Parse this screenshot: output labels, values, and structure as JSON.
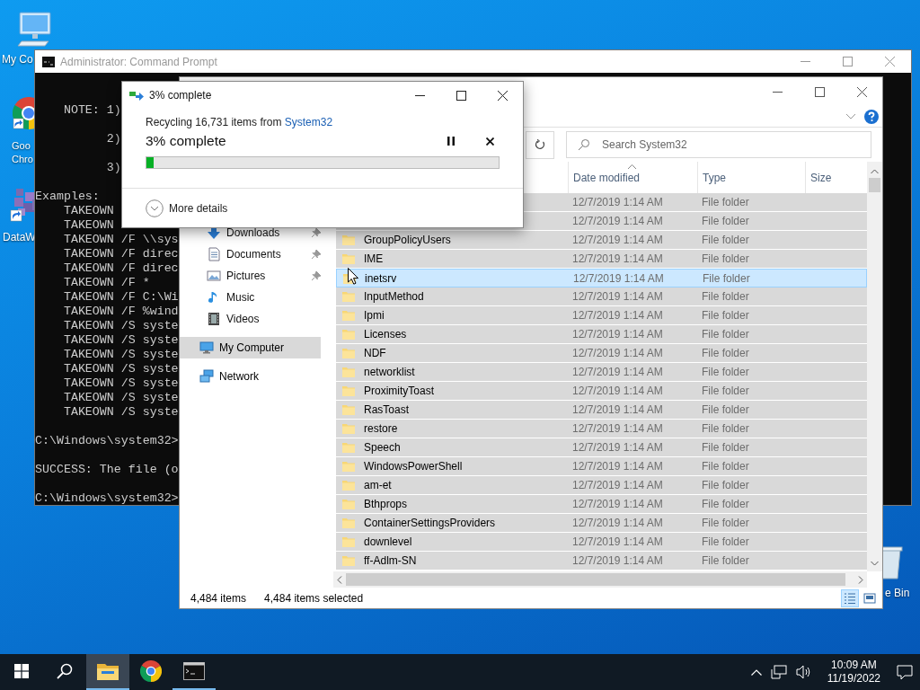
{
  "desktop": {
    "icons": [
      {
        "label": "My Co",
        "kind": "computer",
        "shortcut": false
      },
      {
        "label": "Goo Chro",
        "kind": "chrome",
        "shortcut": true
      },
      {
        "label": "DataW",
        "kind": "app",
        "shortcut": true
      },
      {
        "label": "e Bin",
        "kind": "recycle",
        "shortcut": false
      }
    ]
  },
  "console": {
    "title": "Administrator: Command Prompt",
    "blocks": [
      [
        "    NOTE: 1)"
      ],
      [
        "          2)"
      ],
      [
        "          3)"
      ],
      [
        "Examples:",
        "    TAKEOWN",
        "    TAKEOWN",
        "    TAKEOWN /F \\\\sys",
        "    TAKEOWN /F direc",
        "    TAKEOWN /F direc",
        "    TAKEOWN /F *",
        "    TAKEOWN /F C:\\Wi",
        "    TAKEOWN /F %wind",
        "    TAKEOWN /S syste",
        "    TAKEOWN /S syste",
        "    TAKEOWN /S syste",
        "    TAKEOWN /S syste",
        "    TAKEOWN /S syste",
        "    TAKEOWN /S syste",
        "    TAKEOWN /S syste"
      ],
      [
        "C:\\Windows\\system32>"
      ],
      [
        "SUCCESS: The file (o"
      ],
      [
        "C:\\Windows\\system32>"
      ]
    ]
  },
  "explorer": {
    "search": {
      "placeholder": "Search System32"
    },
    "quick_access": [
      {
        "label": "Downloads",
        "kind": "downloads",
        "pinned": true
      },
      {
        "label": "Documents",
        "kind": "documents",
        "pinned": true
      },
      {
        "label": "Pictures",
        "kind": "pictures",
        "pinned": true
      },
      {
        "label": "Music",
        "kind": "music",
        "pinned": false
      },
      {
        "label": "Videos",
        "kind": "videos",
        "pinned": false
      }
    ],
    "locations": [
      {
        "label": "My Computer",
        "kind": "computer",
        "selected": true
      },
      {
        "label": "Network",
        "kind": "network",
        "selected": false
      }
    ],
    "columns": [
      {
        "label": "Date modified",
        "sorted": true
      },
      {
        "label": "Type",
        "sorted": false
      },
      {
        "label": "Size",
        "sorted": false
      }
    ],
    "rows": [
      {
        "date": "12/7/2019 1:14 AM",
        "type": "File folder",
        "selected": true,
        "hovered": false
      },
      {
        "date": "12/7/2019 1:14 AM",
        "type": "File folder",
        "selected": true,
        "hovered": false
      },
      {
        "name": "GroupPolicyUsers",
        "date": "12/7/2019 1:14 AM",
        "type": "File folder",
        "selected": true,
        "hovered": false
      },
      {
        "name": "IME",
        "date": "12/7/2019 1:14 AM",
        "type": "File folder",
        "selected": true,
        "hovered": false
      },
      {
        "name": "inetsrv",
        "date": "12/7/2019 1:14 AM",
        "type": "File folder",
        "selected": true,
        "hovered": true
      },
      {
        "name": "InputMethod",
        "date": "12/7/2019 1:14 AM",
        "type": "File folder",
        "selected": true,
        "hovered": false
      },
      {
        "name": "Ipmi",
        "date": "12/7/2019 1:14 AM",
        "type": "File folder",
        "selected": true,
        "hovered": false
      },
      {
        "name": "Licenses",
        "date": "12/7/2019 1:14 AM",
        "type": "File folder",
        "selected": true,
        "hovered": false
      },
      {
        "name": "NDF",
        "date": "12/7/2019 1:14 AM",
        "type": "File folder",
        "selected": true,
        "hovered": false
      },
      {
        "name": "networklist",
        "date": "12/7/2019 1:14 AM",
        "type": "File folder",
        "selected": true,
        "hovered": false
      },
      {
        "name": "ProximityToast",
        "date": "12/7/2019 1:14 AM",
        "type": "File folder",
        "selected": true,
        "hovered": false
      },
      {
        "name": "RasToast",
        "date": "12/7/2019 1:14 AM",
        "type": "File folder",
        "selected": true,
        "hovered": false
      },
      {
        "name": "restore",
        "date": "12/7/2019 1:14 AM",
        "type": "File folder",
        "selected": true,
        "hovered": false
      },
      {
        "name": "Speech",
        "date": "12/7/2019 1:14 AM",
        "type": "File folder",
        "selected": true,
        "hovered": false
      },
      {
        "name": "WindowsPowerShell",
        "date": "12/7/2019 1:14 AM",
        "type": "File folder",
        "selected": true,
        "hovered": false
      },
      {
        "name": "am-et",
        "date": "12/7/2019 1:14 AM",
        "type": "File folder",
        "selected": true,
        "hovered": false
      },
      {
        "name": "Bthprops",
        "date": "12/7/2019 1:14 AM",
        "type": "File folder",
        "selected": true,
        "hovered": false
      },
      {
        "name": "ContainerSettingsProviders",
        "date": "12/7/2019 1:14 AM",
        "type": "File folder",
        "selected": true,
        "hovered": false
      },
      {
        "name": "downlevel",
        "date": "12/7/2019 1:14 AM",
        "type": "File folder",
        "selected": true,
        "hovered": false
      },
      {
        "name": "ff-Adlm-SN",
        "date": "12/7/2019 1:14 AM",
        "type": "File folder",
        "selected": true,
        "hovered": false
      }
    ],
    "status": {
      "count": "4,484 items",
      "selection": "4,484 items selected"
    },
    "views": [
      {
        "kind": "details",
        "selected": true
      },
      {
        "kind": "icons",
        "selected": false
      }
    ]
  },
  "dialog": {
    "title": "3% complete",
    "message": "Recycling 16,731 items from ",
    "source": "System32",
    "progress_label": "3% complete",
    "level": 0.02,
    "details": "More details"
  },
  "taskbar": {
    "apps": [
      {
        "kind": "explorer",
        "active": true,
        "running": true
      },
      {
        "kind": "chrome",
        "active": false,
        "running": false
      },
      {
        "kind": "terminal",
        "active": false,
        "running": true
      }
    ],
    "time": "10:09 AM",
    "date": "11/19/2022"
  }
}
